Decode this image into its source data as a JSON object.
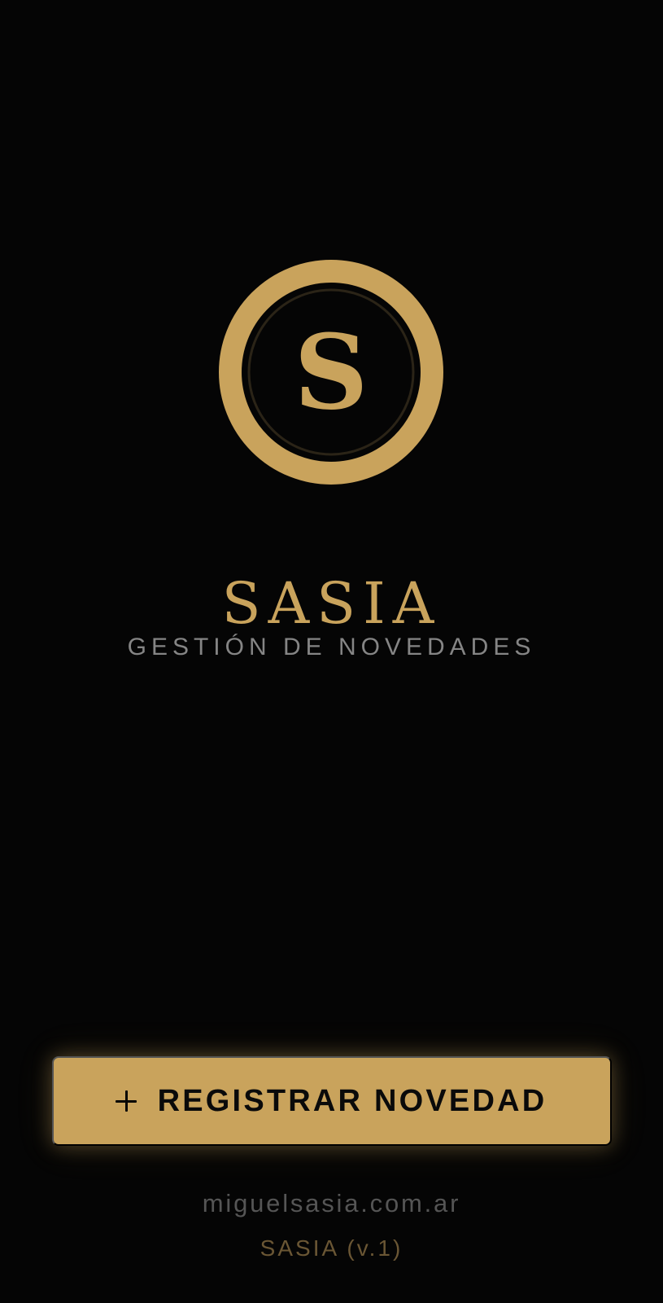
{
  "app": {
    "brand_name": "SASIA",
    "subtitle": "GESTIÓN DE NOVEDADES",
    "logo_letter": "S",
    "logo_icon": "circle-monogram-s-icon"
  },
  "actions": {
    "primary_button_label": "REGISTRAR NOVEDAD",
    "primary_button_icon": "plus-icon"
  },
  "footer": {
    "domain": "miguelsasia.com.ar",
    "version_label": "SASIA (v.1)"
  },
  "colors": {
    "background": "#050505",
    "gold": "#c9a35c",
    "subtitle_gray": "#858585",
    "footer_gray": "#555555",
    "footer_gold_muted": "#6a5634"
  }
}
